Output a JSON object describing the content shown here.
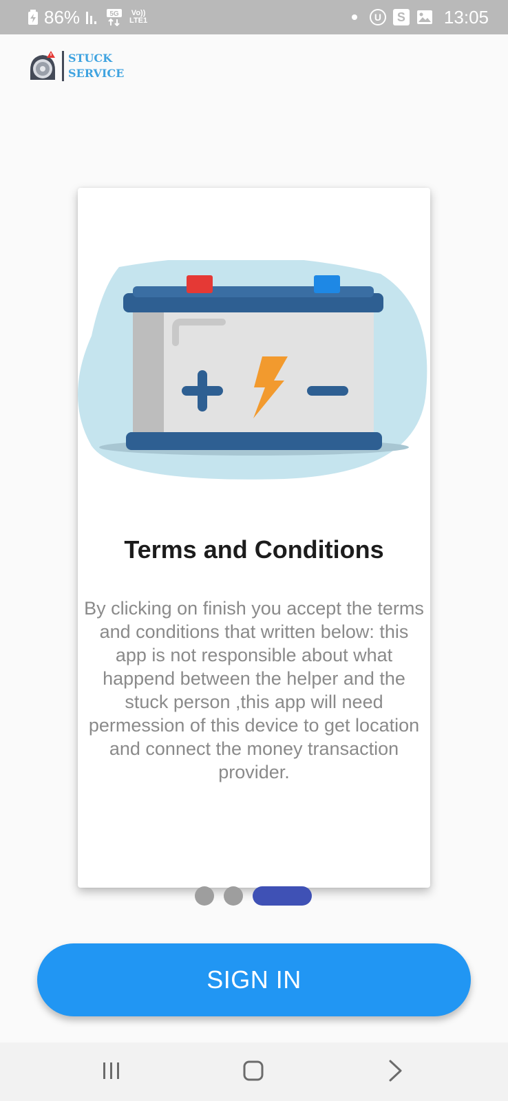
{
  "status_bar": {
    "battery_percent": "86%",
    "network": "5G",
    "volte_line1": "Vo))",
    "volte_line2": "LTE1",
    "u_icon_letter": "U",
    "s_icon_letter": "S",
    "time": "13:05"
  },
  "app": {
    "logo_line1": "STUCK",
    "logo_line2": "SERVICE"
  },
  "onboarding": {
    "title": "Terms and Conditions",
    "body": "By clicking on finish you accept the terms and conditions that written below: this app is not responsible about what happend between the helper and the stuck person ,this app will need permession of this device to get location and connect the money transaction provider.",
    "page_count": 3,
    "current_page": 3
  },
  "actions": {
    "sign_in_label": "SIGN IN"
  },
  "colors": {
    "accent": "#2196f3",
    "pager_active": "#3f51b5",
    "pager_inactive": "#9e9e9e",
    "status_bar": "#b9b9b9",
    "logo_text": "#3fa3e0"
  },
  "icons": {
    "status_left": [
      "battery-charging-icon",
      "signal-bars-icon",
      "5g-icon",
      "volte-icon"
    ],
    "status_right": [
      "notification-dot-icon",
      "u-icon",
      "s-icon",
      "gallery-icon"
    ],
    "nav": [
      "recent-apps-icon",
      "home-icon",
      "back-icon"
    ]
  }
}
